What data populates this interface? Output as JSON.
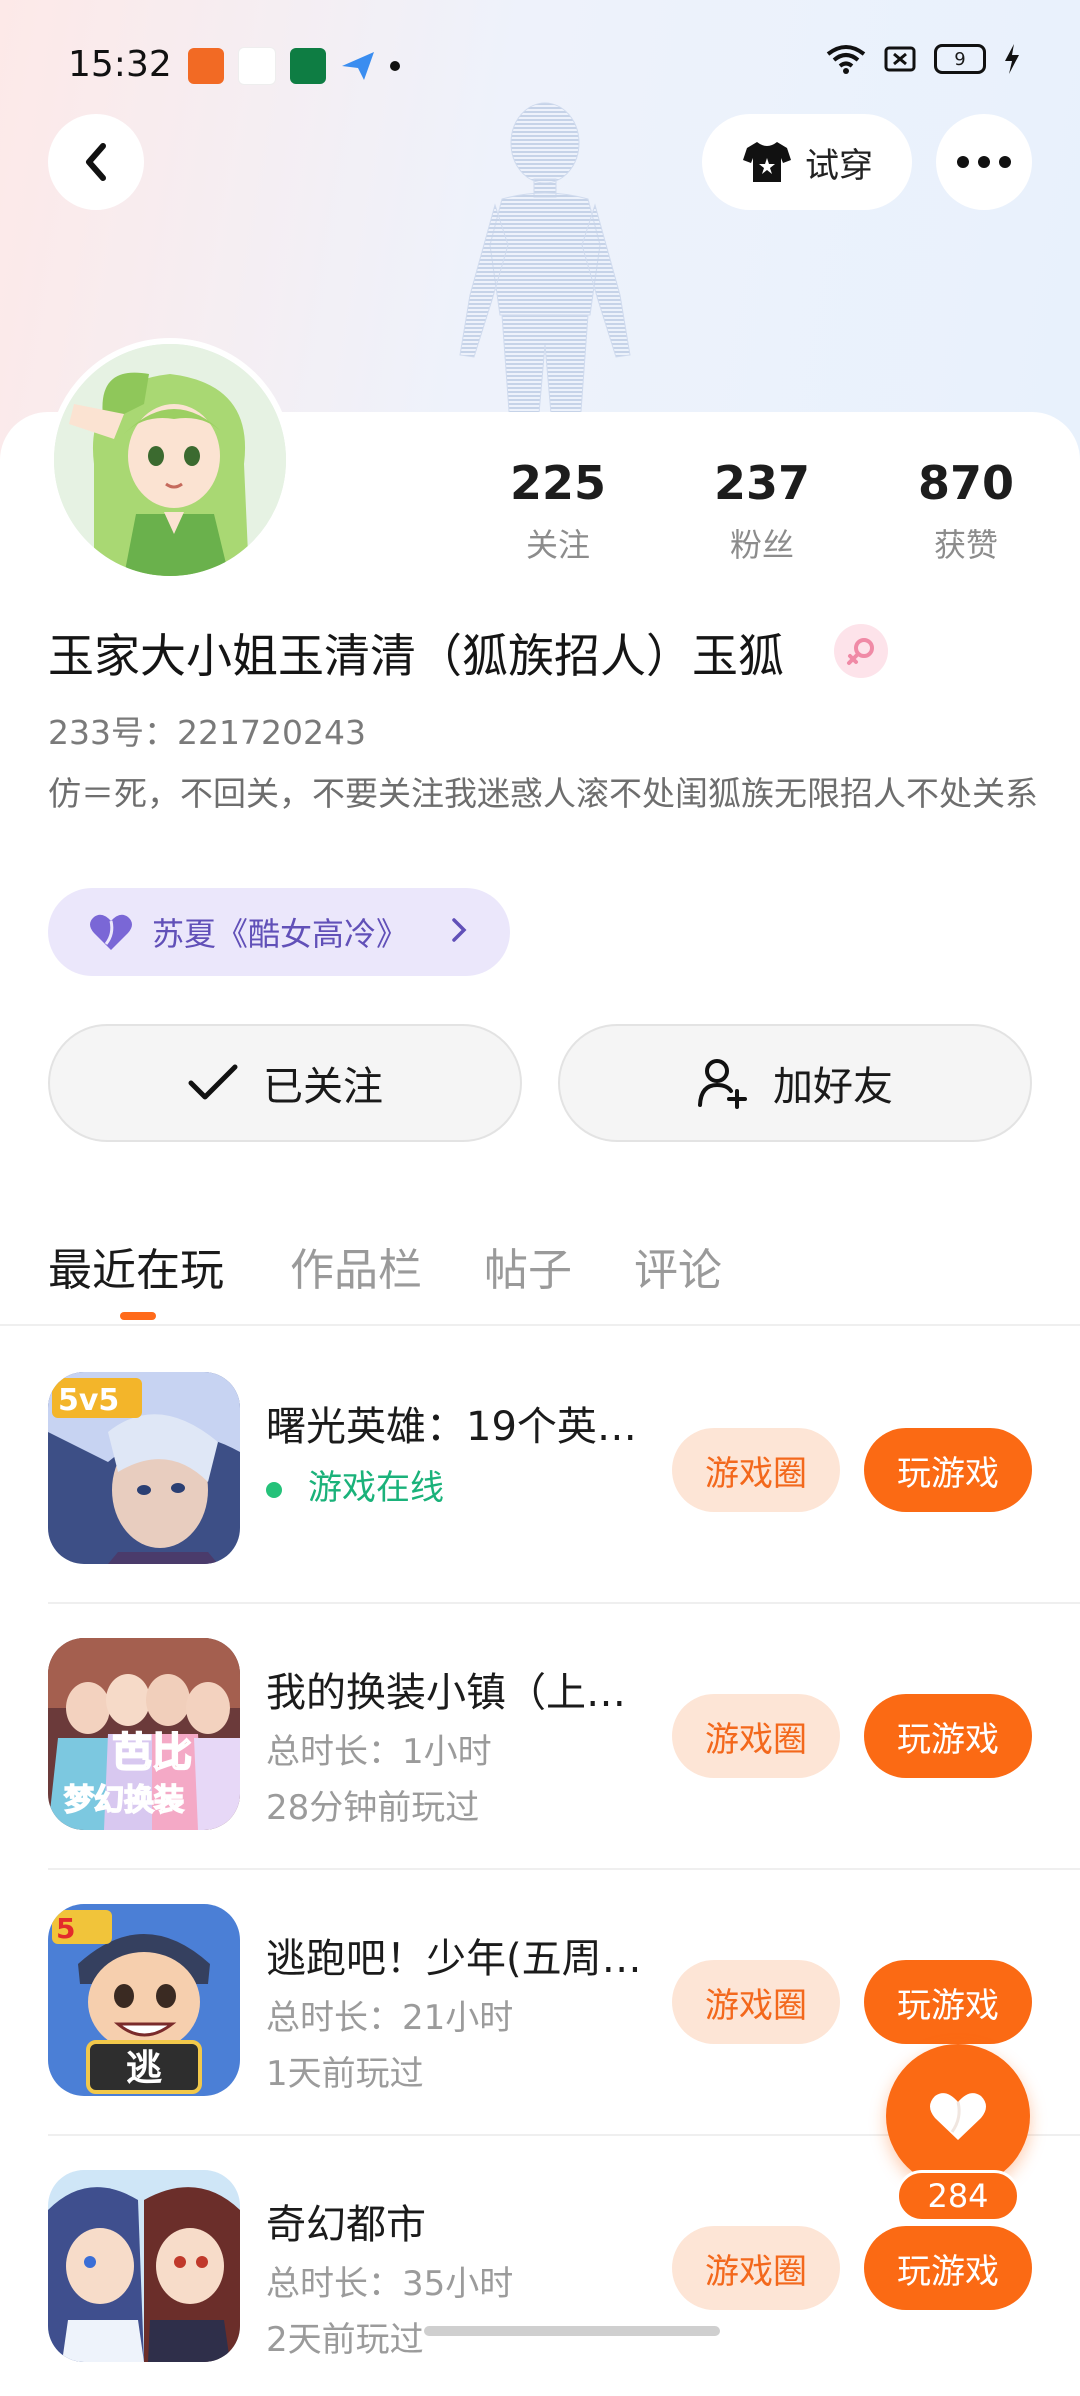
{
  "status_bar": {
    "time": "15:32",
    "battery": "9"
  },
  "header": {
    "back_icon": "chevron-left-icon",
    "tryon_label": "试穿",
    "more_icon": "more-dots-icon"
  },
  "profile": {
    "stats": [
      {
        "value": "225",
        "label": "关注"
      },
      {
        "value": "237",
        "label": "粉丝"
      },
      {
        "value": "870",
        "label": "获赞"
      }
    ],
    "nickname": "玉家大小姐玉清清（狐族招人）玉狐",
    "uid": "233号：221720243",
    "bio": "仿＝死，不回关，不要关注我迷惑人滚不处闺狐族无限招人不处关系",
    "tag": "苏夏《酷女高冷》",
    "followed_label": "已关注",
    "add_friend_label": "加好友",
    "colors": {
      "accent": "#fb6a14",
      "tag_bg": "#ebe7fb",
      "tag_text": "#6150b8"
    }
  },
  "tabs": [
    {
      "label": "最近在玩",
      "active": true
    },
    {
      "label": "作品栏",
      "active": false
    },
    {
      "label": "帖子",
      "active": false
    },
    {
      "label": "评论",
      "active": false
    }
  ],
  "games": [
    {
      "title": "曙光英雄：19个英…",
      "line1": "游戏在线",
      "line2": "",
      "online": true,
      "circle_label": "游戏圈",
      "play_label": "玩游戏"
    },
    {
      "title": "我的换装小镇（上…",
      "line1": "总时长：1小时",
      "line2": "28分钟前玩过",
      "online": false,
      "circle_label": "游戏圈",
      "play_label": "玩游戏"
    },
    {
      "title": "逃跑吧！少年(五周…",
      "line1": "总时长：21小时",
      "line2": "1天前玩过",
      "online": false,
      "circle_label": "游戏圈",
      "play_label": "玩游戏"
    },
    {
      "title": "奇幻都市",
      "line1": "总时长：35小时",
      "line2": "2天前玩过",
      "online": false,
      "circle_label": "游戏圈",
      "play_label": "玩游戏"
    }
  ],
  "like_fab": {
    "count": "284"
  }
}
